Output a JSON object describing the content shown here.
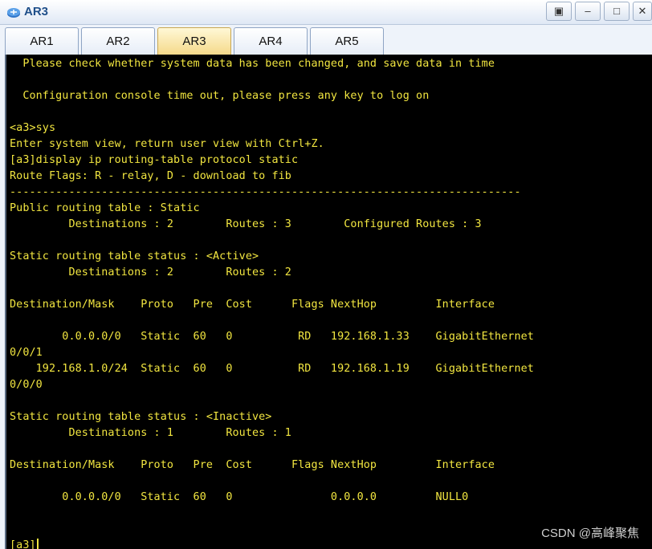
{
  "window": {
    "title": "AR3",
    "icon": "router-app-icon",
    "controls": [
      "restore-down-icon",
      "minimize-icon",
      "maximize-icon",
      "close-icon"
    ]
  },
  "tabs": [
    {
      "label": "AR1"
    },
    {
      "label": "AR2"
    },
    {
      "label": "AR3",
      "active": true
    },
    {
      "label": "AR4"
    },
    {
      "label": "AR5"
    }
  ],
  "console": {
    "text_color": "#f2e640",
    "background": "#000000",
    "lines": [
      "  Please check whether system data has been changed, and save data in time",
      "",
      "  Configuration console time out, please press any key to log on",
      "",
      "<a3>sys",
      "Enter system view, return user view with Ctrl+Z.",
      "[a3]display ip routing-table protocol static",
      "Route Flags: R - relay, D - download to fib",
      "------------------------------------------------------------------------------",
      "Public routing table : Static",
      "         Destinations : 2        Routes : 3        Configured Routes : 3",
      "",
      "Static routing table status : <Active>",
      "         Destinations : 2        Routes : 2",
      "",
      "Destination/Mask    Proto   Pre  Cost      Flags NextHop         Interface",
      "",
      "        0.0.0.0/0   Static  60   0          RD   192.168.1.33    GigabitEthernet",
      "0/0/1",
      "    192.168.1.0/24  Static  60   0          RD   192.168.1.19    GigabitEthernet",
      "0/0/0",
      "",
      "Static routing table status : <Inactive>",
      "         Destinations : 1        Routes : 1",
      "",
      "Destination/Mask    Proto   Pre  Cost      Flags NextHop         Interface",
      "",
      "        0.0.0.0/0   Static  60   0               0.0.0.0         NULL0",
      "",
      "",
      "[a3]"
    ]
  },
  "watermark": "CSDN @高峰聚焦"
}
